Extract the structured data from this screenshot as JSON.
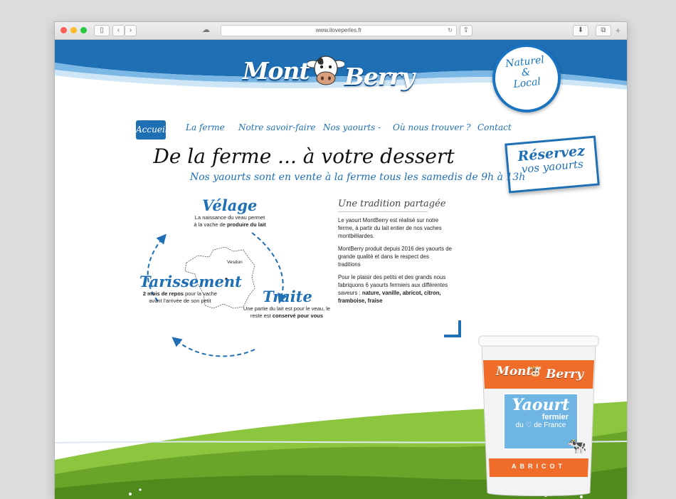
{
  "browser": {
    "url": "www.iloveperles.fr"
  },
  "brand": {
    "logo_part1": "Mont",
    "logo_part2": "Berry",
    "badge_line1": "Naturel",
    "badge_line2": "&",
    "badge_line3": "Local",
    "blue": "#1f6fb5",
    "green": "#6aa52a"
  },
  "nav": {
    "items": [
      "Accueil",
      "La ferme",
      "Notre savoir-faire",
      "Nos yaourts -",
      "Où nous trouver ?",
      "Contact"
    ]
  },
  "reserve": {
    "line1": "Réservez",
    "line2": "vos yaourts"
  },
  "hero": {
    "title": "De la ferme ... à votre dessert",
    "subtitle": "Nos yaourts sont en vente à la ferme tous les samedis de 9h à 13h"
  },
  "cycle": {
    "velage": {
      "title": "Vélage",
      "desc_pre": "La naissance du veau permet",
      "desc_mid": "à la vache de ",
      "desc_bold": "produire du lait"
    },
    "traite": {
      "title": "Traite",
      "desc_pre": "Une partie du lait est pour le veau, le",
      "desc_mid": "reste est ",
      "desc_bold": "conservé pour vous"
    },
    "tarissement": {
      "title": "Tarissement",
      "desc_bold": "2 mois de repos",
      "desc_pre": " pour la vache",
      "desc_post": "avant l'arrivée de son petit"
    },
    "map_label": "Vesdun"
  },
  "tradition": {
    "title": "Une tradition partagée",
    "p1": "Le yaourt MontBerry est réalisé sur notre ferme, à partir du lait entier de nos vaches montbéliardes.",
    "p2": "MontBerry produit depuis 2016 des yaourts de grande qualité et dans le respect des traditions",
    "p3_pre": "Pour le plaisir des petits et des grands nous fabriquons 6 yaourts fermiers aux différentes saveurs : ",
    "p3_bold": "nature, vanille, abricot, citron, framboise, fraise"
  },
  "cup": {
    "logo_part1": "Mont",
    "logo_part2": "Berry",
    "yaourt": "Yaourt",
    "fermier": "fermier",
    "du": "du",
    "france": "de France",
    "flavor": "ABRICOT"
  }
}
